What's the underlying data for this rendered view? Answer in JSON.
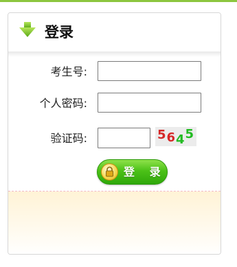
{
  "header": {
    "title": "登录",
    "icon": "green-down-arrow-icon",
    "accent_color": "#8cc63f"
  },
  "form": {
    "exam_number_label": "考生号:",
    "exam_number_value": "",
    "password_label": "个人密码:",
    "password_value": "",
    "captcha_label": "验证码:",
    "captcha_value": "",
    "captcha_chars": [
      {
        "char": "5",
        "color": "#d62828"
      },
      {
        "char": "6",
        "color": "#d62828"
      },
      {
        "char": "4",
        "color": "#22bb22"
      },
      {
        "char": "5",
        "color": "#22bb22"
      }
    ]
  },
  "login_button": {
    "label": "登 录",
    "icon": "lock-icon",
    "color": "#4cc118"
  }
}
